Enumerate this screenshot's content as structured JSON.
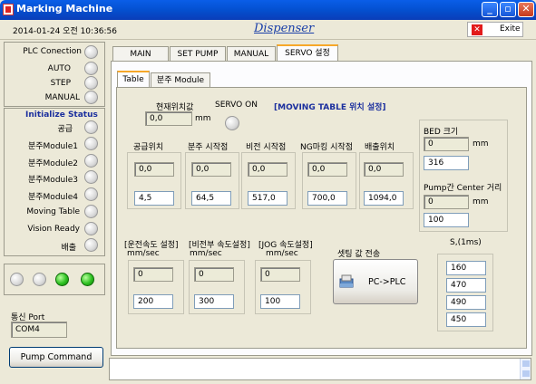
{
  "window": {
    "title": "Marking Machine",
    "min": "_",
    "max": "▫",
    "close": "✕"
  },
  "header": {
    "datetime": "2014-01-24 오전 10:36:56",
    "app_title": "Dispenser",
    "exit_label": "Exite",
    "exit_icon": "✕"
  },
  "status_panel": {
    "plc_connection": "PLC Conection",
    "auto": "AUTO",
    "step": "STEP",
    "manual": "MANUAL",
    "init_title": "Initialize  Status",
    "items": [
      "공급",
      "분주Module1",
      "분주Module2",
      "분주Module3",
      "분주Module4",
      "Moving Table",
      "Vision Ready",
      "배출"
    ],
    "leds": [
      false,
      false,
      true,
      true
    ],
    "port_label": "통신 Port",
    "port_value": "COM4",
    "pump_command": "Pump Command"
  },
  "tabs": [
    "MAIN",
    "SET PUMP",
    "MANUAL",
    "SERVO 설정"
  ],
  "subtabs": [
    "Table",
    "분주 Module"
  ],
  "servo": {
    "current_pos_label": "현재위치값",
    "current_pos_value": "0,0",
    "unit_mm": "mm",
    "servo_on": "SERVO ON",
    "section_title": "[MOVING TABLE 위치 설정]",
    "positions": [
      {
        "label": "공급위치",
        "read": "0,0",
        "set": "4,5"
      },
      {
        "label": "분주 시작점",
        "read": "0,0",
        "set": "64,5"
      },
      {
        "label": "비전 시작점",
        "read": "0,0",
        "set": "517,0"
      },
      {
        "label": "NG마킹 시작점",
        "read": "0,0",
        "set": "700,0"
      },
      {
        "label": "배출위치",
        "read": "0,0",
        "set": "1094,0"
      }
    ],
    "bed": {
      "label": "BED 크기",
      "read": "0",
      "unit": "mm",
      "set": "316"
    },
    "pump_center": {
      "label": "Pump간 Center 거리",
      "read": "0",
      "unit": "mm",
      "set": "100"
    },
    "speeds": [
      {
        "label": "[운전속도 설정]",
        "unit": "mm/sec",
        "read": "0",
        "set": "200"
      },
      {
        "label": "[비전부 속도설정]",
        "unit": "mm/sec",
        "read": "0",
        "set": "300"
      },
      {
        "label": "[JOG 속도설정]",
        "unit": "mm/sec",
        "read": "0",
        "set": "100"
      }
    ],
    "transfer_label": "셋팅 값 전송",
    "transfer_button": "PC->PLC",
    "s_label": "S,(1ms)",
    "s_values": [
      "160",
      "470",
      "490",
      "450"
    ]
  }
}
